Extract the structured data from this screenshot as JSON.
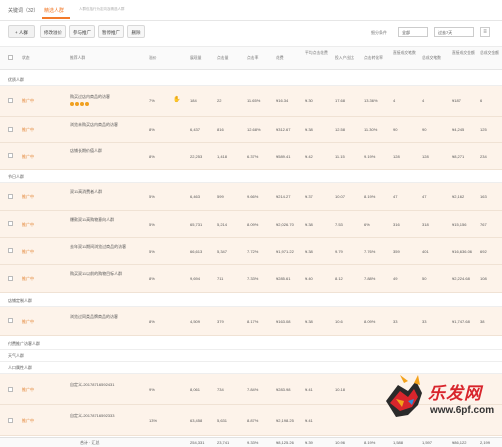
{
  "tabs": [
    {
      "label": "关键词（32）"
    },
    {
      "label": "精选人群"
    }
  ],
  "hint": "人群包括行为定向及精选人群",
  "toolbar": {
    "add_label": "+ 人群",
    "bid_label": "修改溢价",
    "pause_label": "参与推广",
    "stop_label": "暂停推广",
    "delete_label": "删除",
    "filter_label": "细分条件",
    "filter_value": "全部",
    "date_value": "过去7天"
  },
  "columns": [
    "状态",
    "推荐人群",
    "溢价",
    "展现量",
    "点击量",
    "点击率",
    "花费",
    "平均点击花费",
    "投入产出比",
    "点击转化率",
    "直接成交笔数",
    "总成交笔数",
    "直接成交金额",
    "总成交金额"
  ],
  "groups": [
    {
      "name": "优质人群",
      "rows": [
        {
          "status": "推广中",
          "name": "购买过店内商品的访客",
          "extra": true,
          "premium": "7%",
          "impressions": "184",
          "clicks": "22",
          "ctr": "11.65%",
          "cost": "¥16.34",
          "cpc": "¥.30",
          "roi": "17.68",
          "cvr": "13.36%",
          "d_orders": "4",
          "t_orders": "4",
          "d_amount": "¥187",
          "t_amount": "6"
        },
        {
          "status": "推广中",
          "name": "浏览未购买店内商品的访客",
          "extra": false,
          "premium": "8%",
          "impressions": "6,437",
          "clicks": "816",
          "ctr": "12.68%",
          "cost": "¥312.67",
          "cpc": "¥.38",
          "roi": "12.58",
          "cvr": "11.30%",
          "d_orders": "90",
          "t_orders": "90",
          "d_amount": "¥4,245",
          "t_amount": "125"
        },
        {
          "status": "推广中",
          "name": "店铺长期价值人群",
          "extra": false,
          "premium": "8%",
          "impressions": "22,253",
          "clicks": "1,418",
          "ctr": "6.37%",
          "cost": "¥589.41",
          "cpc": "¥.42",
          "roi": "11.15",
          "cvr": "9.19%",
          "d_orders": "128",
          "t_orders": "128",
          "d_amount": "¥8,271",
          "t_amount": "234"
        }
      ]
    },
    {
      "name": "节日人群",
      "rows": [
        {
          "status": "推广中",
          "name": "双11高消费者人群",
          "extra": false,
          "premium": "5%",
          "impressions": "6,463",
          "clicks": "599",
          "ctr": "9.66%",
          "cost": "¥214.27",
          "cpc": "¥.37",
          "roi": "10.07",
          "cvr": "8.19%",
          "d_orders": "47",
          "t_orders": "47",
          "d_amount": "¥2,162",
          "t_amount": "163"
        },
        {
          "status": "推广中",
          "name": "爆款双11高购物意向人群",
          "extra": false,
          "premium": "5%",
          "impressions": "65,731",
          "clicks": "5,214",
          "ctr": "8.09%",
          "cost": "¥2,026.70",
          "cpc": "¥.38",
          "roi": "7.53",
          "cvr": "6%",
          "d_orders": "316",
          "t_orders": "318",
          "d_amount": "¥15,156",
          "t_amount": "767"
        },
        {
          "status": "推广中",
          "name": "去年双11期间浏览过商品的访客",
          "extra": false,
          "premium": "5%",
          "impressions": "66,613",
          "clicks": "5,347",
          "ctr": "7.72%",
          "cost": "¥1,971.22",
          "cpc": "¥.38",
          "roi": "9.79",
          "cvr": "7.76%",
          "d_orders": "359",
          "t_orders": "401",
          "d_amount": "¥16,636.06",
          "t_amount": "692"
        },
        {
          "status": "推广中",
          "name": "购买双11以前的购物目标人群",
          "extra": false,
          "premium": "8%",
          "impressions": "9,694",
          "clicks": "711",
          "ctr": "7.33%",
          "cost": "¥285.61",
          "cpc": "¥.40",
          "roi": "8.12",
          "cvr": "7.88%",
          "d_orders": "49",
          "t_orders": "50",
          "d_amount": "¥2,224.68",
          "t_amount": "108"
        }
      ]
    },
    {
      "name": "店铺定制人群",
      "rows": [
        {
          "status": "推广中",
          "name": "浏览过同类品牌商品的访客",
          "extra": false,
          "premium": "8%",
          "impressions": "4,509",
          "clicks": "379",
          "ctr": "8.17%",
          "cost": "¥163.08",
          "cpc": "¥.38",
          "roi": "10.6",
          "cvr": "8.09%",
          "d_orders": "33",
          "t_orders": "33",
          "d_amount": "¥1,747.68",
          "t_amount": "38"
        }
      ]
    },
    {
      "name": "付费推广访客人群",
      "rows": []
    },
    {
      "name": "天气人群",
      "rows": []
    },
    {
      "name": "人口属性人群",
      "rows": [
        {
          "status": "推广中",
          "name": "自定义-20178716592431",
          "extra": false,
          "premium": "9%",
          "impressions": "8,061",
          "clicks": "734",
          "ctr": "7.84%",
          "cost": "¥283.98",
          "cpc": "¥.41",
          "roi": "10.18",
          "cvr": "",
          "d_orders": "",
          "t_orders": "",
          "d_amount": "",
          "t_amount": ""
        },
        {
          "status": "推广中",
          "name": "自定义-20178716592333",
          "extra": false,
          "premium": "13%",
          "impressions": "63,458",
          "clicks": "5,631",
          "ctr": "8.87%",
          "cost": "¥2,198.25",
          "cpc": "¥.41",
          "roi": "",
          "cvr": "",
          "d_orders": "",
          "t_orders": "",
          "d_amount": "",
          "t_amount": ""
        }
      ]
    }
  ],
  "summary": {
    "label": "合计 · 汇总",
    "impressions": "254,331",
    "clicks": "23,741",
    "ctr": "9.33%",
    "cost": "¥8,125.26",
    "cpc": "¥.39",
    "roi": "10.96",
    "cvr": "8.19%",
    "d_orders": "1,588",
    "t_orders": "1,597",
    "d_amount": "¥86,122",
    "t_amount": "2,199"
  },
  "watermark": {
    "brand": "乐发网",
    "url": "www.6pf.com"
  },
  "colors": {
    "accent": "#f27a2a",
    "row_bg": "#fdf3ea"
  }
}
